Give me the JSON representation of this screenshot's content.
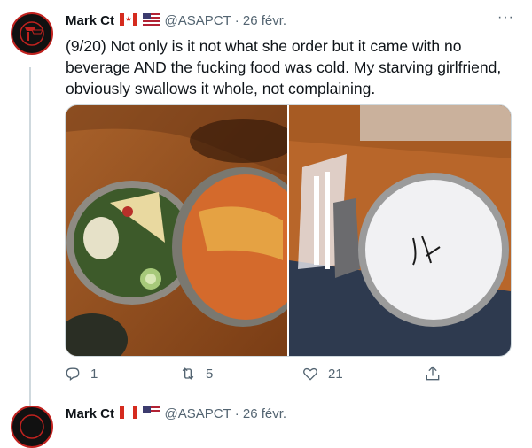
{
  "tweet": {
    "author_name": "Mark Ct",
    "handle": "@ASAPCT",
    "separator": "·",
    "date": "26 févr.",
    "more_label": "···",
    "text": "(9/20) Not only is it not what she order but it came with no beverage AND the fucking food was cold. My starving girlfriend, obviously swallows it whole, not complaining.",
    "stats": {
      "replies": "1",
      "retweets": "5",
      "likes": "21"
    },
    "icons": {
      "reply": "reply-icon",
      "retweet": "retweet-icon",
      "like": "heart-icon",
      "share": "share-icon"
    }
  },
  "next_tweet": {
    "author_name": "Mark Ct",
    "handle": "@ASAPCT",
    "separator": "·",
    "date": "26 févr."
  },
  "colors": {
    "secondary_text": "#536471",
    "border": "#cfd9de",
    "avatar_red": "#c0221f"
  }
}
